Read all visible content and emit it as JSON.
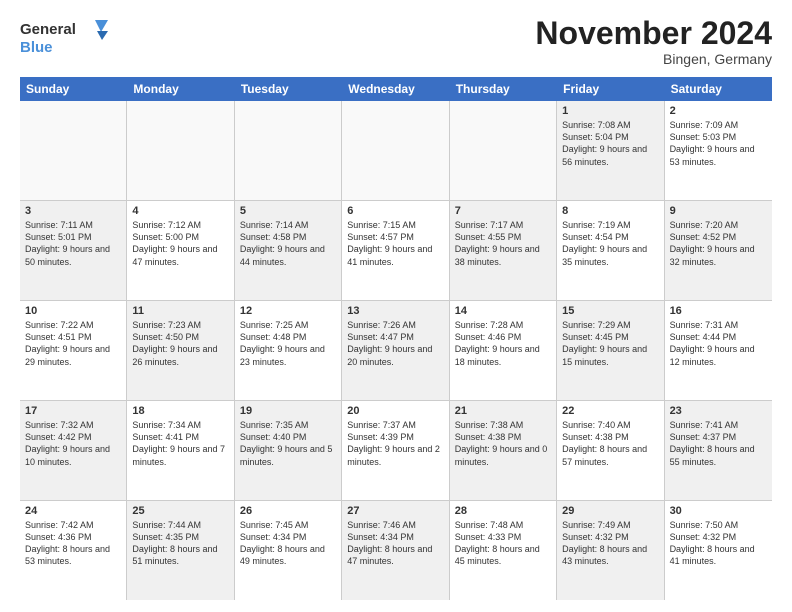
{
  "logo": {
    "line1": "General",
    "line2": "Blue"
  },
  "title": "November 2024",
  "location": "Bingen, Germany",
  "header_days": [
    "Sunday",
    "Monday",
    "Tuesday",
    "Wednesday",
    "Thursday",
    "Friday",
    "Saturday"
  ],
  "rows": [
    [
      {
        "day": "",
        "text": "",
        "empty": true
      },
      {
        "day": "",
        "text": "",
        "empty": true
      },
      {
        "day": "",
        "text": "",
        "empty": true
      },
      {
        "day": "",
        "text": "",
        "empty": true
      },
      {
        "day": "",
        "text": "",
        "empty": true
      },
      {
        "day": "1",
        "text": "Sunrise: 7:08 AM\nSunset: 5:04 PM\nDaylight: 9 hours and 56 minutes.",
        "shaded": true
      },
      {
        "day": "2",
        "text": "Sunrise: 7:09 AM\nSunset: 5:03 PM\nDaylight: 9 hours and 53 minutes.",
        "shaded": false
      }
    ],
    [
      {
        "day": "3",
        "text": "Sunrise: 7:11 AM\nSunset: 5:01 PM\nDaylight: 9 hours and 50 minutes.",
        "shaded": true
      },
      {
        "day": "4",
        "text": "Sunrise: 7:12 AM\nSunset: 5:00 PM\nDaylight: 9 hours and 47 minutes.",
        "shaded": false
      },
      {
        "day": "5",
        "text": "Sunrise: 7:14 AM\nSunset: 4:58 PM\nDaylight: 9 hours and 44 minutes.",
        "shaded": true
      },
      {
        "day": "6",
        "text": "Sunrise: 7:15 AM\nSunset: 4:57 PM\nDaylight: 9 hours and 41 minutes.",
        "shaded": false
      },
      {
        "day": "7",
        "text": "Sunrise: 7:17 AM\nSunset: 4:55 PM\nDaylight: 9 hours and 38 minutes.",
        "shaded": true
      },
      {
        "day": "8",
        "text": "Sunrise: 7:19 AM\nSunset: 4:54 PM\nDaylight: 9 hours and 35 minutes.",
        "shaded": false
      },
      {
        "day": "9",
        "text": "Sunrise: 7:20 AM\nSunset: 4:52 PM\nDaylight: 9 hours and 32 minutes.",
        "shaded": true
      }
    ],
    [
      {
        "day": "10",
        "text": "Sunrise: 7:22 AM\nSunset: 4:51 PM\nDaylight: 9 hours and 29 minutes.",
        "shaded": false
      },
      {
        "day": "11",
        "text": "Sunrise: 7:23 AM\nSunset: 4:50 PM\nDaylight: 9 hours and 26 minutes.",
        "shaded": true
      },
      {
        "day": "12",
        "text": "Sunrise: 7:25 AM\nSunset: 4:48 PM\nDaylight: 9 hours and 23 minutes.",
        "shaded": false
      },
      {
        "day": "13",
        "text": "Sunrise: 7:26 AM\nSunset: 4:47 PM\nDaylight: 9 hours and 20 minutes.",
        "shaded": true
      },
      {
        "day": "14",
        "text": "Sunrise: 7:28 AM\nSunset: 4:46 PM\nDaylight: 9 hours and 18 minutes.",
        "shaded": false
      },
      {
        "day": "15",
        "text": "Sunrise: 7:29 AM\nSunset: 4:45 PM\nDaylight: 9 hours and 15 minutes.",
        "shaded": true
      },
      {
        "day": "16",
        "text": "Sunrise: 7:31 AM\nSunset: 4:44 PM\nDaylight: 9 hours and 12 minutes.",
        "shaded": false
      }
    ],
    [
      {
        "day": "17",
        "text": "Sunrise: 7:32 AM\nSunset: 4:42 PM\nDaylight: 9 hours and 10 minutes.",
        "shaded": true
      },
      {
        "day": "18",
        "text": "Sunrise: 7:34 AM\nSunset: 4:41 PM\nDaylight: 9 hours and 7 minutes.",
        "shaded": false
      },
      {
        "day": "19",
        "text": "Sunrise: 7:35 AM\nSunset: 4:40 PM\nDaylight: 9 hours and 5 minutes.",
        "shaded": true
      },
      {
        "day": "20",
        "text": "Sunrise: 7:37 AM\nSunset: 4:39 PM\nDaylight: 9 hours and 2 minutes.",
        "shaded": false
      },
      {
        "day": "21",
        "text": "Sunrise: 7:38 AM\nSunset: 4:38 PM\nDaylight: 9 hours and 0 minutes.",
        "shaded": true
      },
      {
        "day": "22",
        "text": "Sunrise: 7:40 AM\nSunset: 4:38 PM\nDaylight: 8 hours and 57 minutes.",
        "shaded": false
      },
      {
        "day": "23",
        "text": "Sunrise: 7:41 AM\nSunset: 4:37 PM\nDaylight: 8 hours and 55 minutes.",
        "shaded": true
      }
    ],
    [
      {
        "day": "24",
        "text": "Sunrise: 7:42 AM\nSunset: 4:36 PM\nDaylight: 8 hours and 53 minutes.",
        "shaded": false
      },
      {
        "day": "25",
        "text": "Sunrise: 7:44 AM\nSunset: 4:35 PM\nDaylight: 8 hours and 51 minutes.",
        "shaded": true
      },
      {
        "day": "26",
        "text": "Sunrise: 7:45 AM\nSunset: 4:34 PM\nDaylight: 8 hours and 49 minutes.",
        "shaded": false
      },
      {
        "day": "27",
        "text": "Sunrise: 7:46 AM\nSunset: 4:34 PM\nDaylight: 8 hours and 47 minutes.",
        "shaded": true
      },
      {
        "day": "28",
        "text": "Sunrise: 7:48 AM\nSunset: 4:33 PM\nDaylight: 8 hours and 45 minutes.",
        "shaded": false
      },
      {
        "day": "29",
        "text": "Sunrise: 7:49 AM\nSunset: 4:32 PM\nDaylight: 8 hours and 43 minutes.",
        "shaded": true
      },
      {
        "day": "30",
        "text": "Sunrise: 7:50 AM\nSunset: 4:32 PM\nDaylight: 8 hours and 41 minutes.",
        "shaded": false
      }
    ]
  ]
}
